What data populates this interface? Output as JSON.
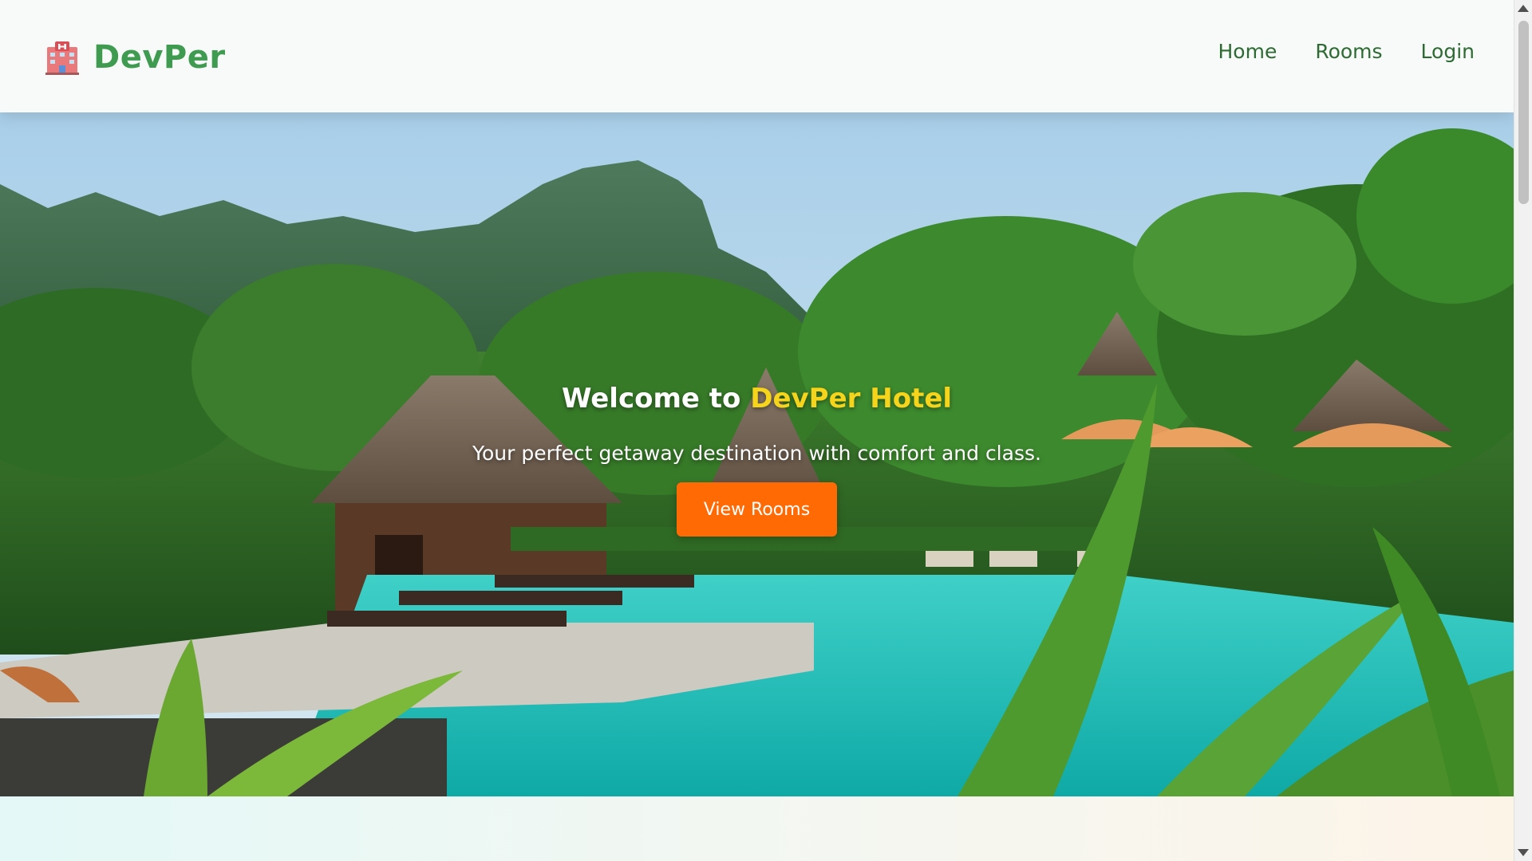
{
  "navbar": {
    "brand_name": "DevPer",
    "brand_icon": "hotel-icon",
    "links": [
      {
        "label": "Home"
      },
      {
        "label": "Rooms"
      },
      {
        "label": "Login"
      }
    ]
  },
  "hero": {
    "title_prefix": "Welcome to ",
    "title_accent": "DevPer Hotel",
    "subtitle": "Your perfect getaway destination with comfort and class.",
    "button_label": "View Rooms"
  },
  "colors": {
    "brand": "#3e9b4f",
    "nav_link": "#2d6b33",
    "accent_title": "#f6d41b",
    "button": "#ff6a05"
  }
}
